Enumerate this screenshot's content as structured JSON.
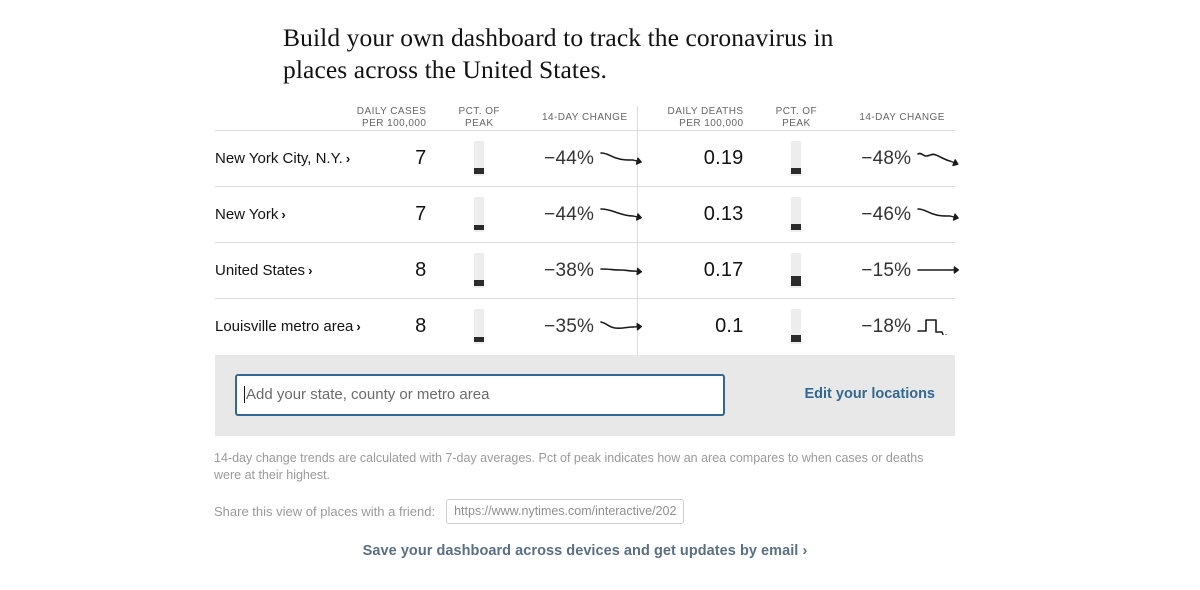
{
  "headline": "Build your own dashboard to track the coronavirus in places across the United States.",
  "table": {
    "headers": {
      "place": "",
      "cases_line1": "DAILY CASES",
      "cases_line2": "PER 100,000",
      "cases_peak_line1": "PCT. OF",
      "cases_peak_line2": "PEAK",
      "cases_change": "14-DAY CHANGE",
      "deaths_line1": "DAILY DEATHS",
      "deaths_line2": "PER 100,000",
      "deaths_peak_line1": "PCT. OF",
      "deaths_peak_line2": "PEAK",
      "deaths_change": "14-DAY CHANGE"
    },
    "rows": [
      {
        "place": "New York City, N.Y.",
        "chevron": "›",
        "cases": "7",
        "cases_peak_pct": 10,
        "cases_change": "−44%",
        "cases_trend": "down-curve",
        "deaths": "0.19",
        "deaths_peak_pct": 12,
        "deaths_change": "−48%",
        "deaths_trend": "wavy-down"
      },
      {
        "place": "New York",
        "chevron": "›",
        "cases": "7",
        "cases_peak_pct": 9,
        "cases_change": "−44%",
        "cases_trend": "down-steady",
        "deaths": "0.13",
        "deaths_peak_pct": 11,
        "deaths_change": "−46%",
        "deaths_trend": "down-curve"
      },
      {
        "place": "United States",
        "chevron": "›",
        "cases": "8",
        "cases_peak_pct": 11,
        "cases_change": "−38%",
        "cases_trend": "down-slight",
        "deaths": "0.17",
        "deaths_peak_pct": 22,
        "deaths_change": "−15%",
        "deaths_trend": "flat"
      },
      {
        "place": "Louisville metro area",
        "chevron": "›",
        "cases": "8",
        "cases_peak_pct": 9,
        "cases_change": "−35%",
        "cases_trend": "dip-up",
        "deaths": "0.1",
        "deaths_peak_pct": 13,
        "deaths_change": "−18%",
        "deaths_trend": "spike"
      }
    ]
  },
  "search": {
    "value": "",
    "placeholder": "Add your state, county or metro area",
    "edit_label": "Edit your locations"
  },
  "footnote": "14-day change trends are calculated with 7-day averages. Pct of peak indicates how an area compares to when cases or deaths were at their highest.",
  "share": {
    "label": "Share this view of places with a friend:",
    "url": "https://www.nytimes.com/interactive/202"
  },
  "save_link": "Save your dashboard across devices and get updates by email ›",
  "colors": {
    "accent_blue": "#326891",
    "save_link": "#5a6f82",
    "panel_bg": "#e8e8e8",
    "peak_track": "#ededed",
    "peak_marker": "#2b2b2b",
    "rule": "#dcdcdc"
  }
}
